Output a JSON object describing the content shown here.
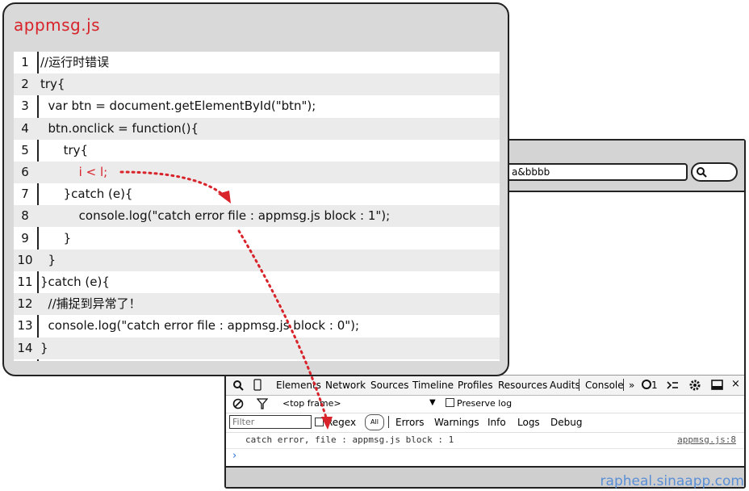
{
  "card": {
    "title": "appmsg.js",
    "lines": [
      {
        "n": "1",
        "text": "//运行时错误",
        "err": false
      },
      {
        "n": "2",
        "text": "try{",
        "err": false
      },
      {
        "n": "3",
        "text": "  var btn = document.getElementById(\"btn\");",
        "err": false
      },
      {
        "n": "4",
        "text": "  btn.onclick = function(){",
        "err": false
      },
      {
        "n": "5",
        "text": "      try{",
        "err": false
      },
      {
        "n": "6",
        "text": "          i < l;",
        "err": true
      },
      {
        "n": "7",
        "text": "      }catch (e){",
        "err": false
      },
      {
        "n": "8",
        "text": "          console.log(\"catch error file : appmsg.js block : 1\");",
        "err": false
      },
      {
        "n": "9",
        "text": "      }",
        "err": false
      },
      {
        "n": "10",
        "text": "  }",
        "err": false
      },
      {
        "n": "11",
        "text": "}catch (e){",
        "err": false
      },
      {
        "n": "12",
        "text": "  //捕捉到异常了！",
        "err": false
      },
      {
        "n": "13",
        "text": "  console.log(\"catch error file : appmsg.js block : 0\");",
        "err": false
      },
      {
        "n": "14",
        "text": "}",
        "err": false
      }
    ]
  },
  "browser": {
    "url_fragment": "a&bbbb"
  },
  "devtools": {
    "tabs": [
      "Elements",
      "Network",
      "Sources",
      "Timeline",
      "Profiles",
      "Resources",
      "Audits",
      "Console"
    ],
    "more": "»",
    "error_count": "1",
    "frame_label": "<top frame>",
    "preserve_log": "Preserve log",
    "filter_placeholder": "Filter",
    "regex": "Regex",
    "all": "All",
    "levels": [
      "Errors",
      "Warnings",
      "Info",
      "Logs",
      "Debug"
    ],
    "console_message": "catch error, file : appmsg.js block : 1",
    "console_source": "appmsg.js:8",
    "prompt": "›"
  },
  "watermark": "rapheal.sinaapp.com",
  "colors": {
    "accent_red": "#d8232a",
    "link_blue": "#5a8fd6"
  }
}
